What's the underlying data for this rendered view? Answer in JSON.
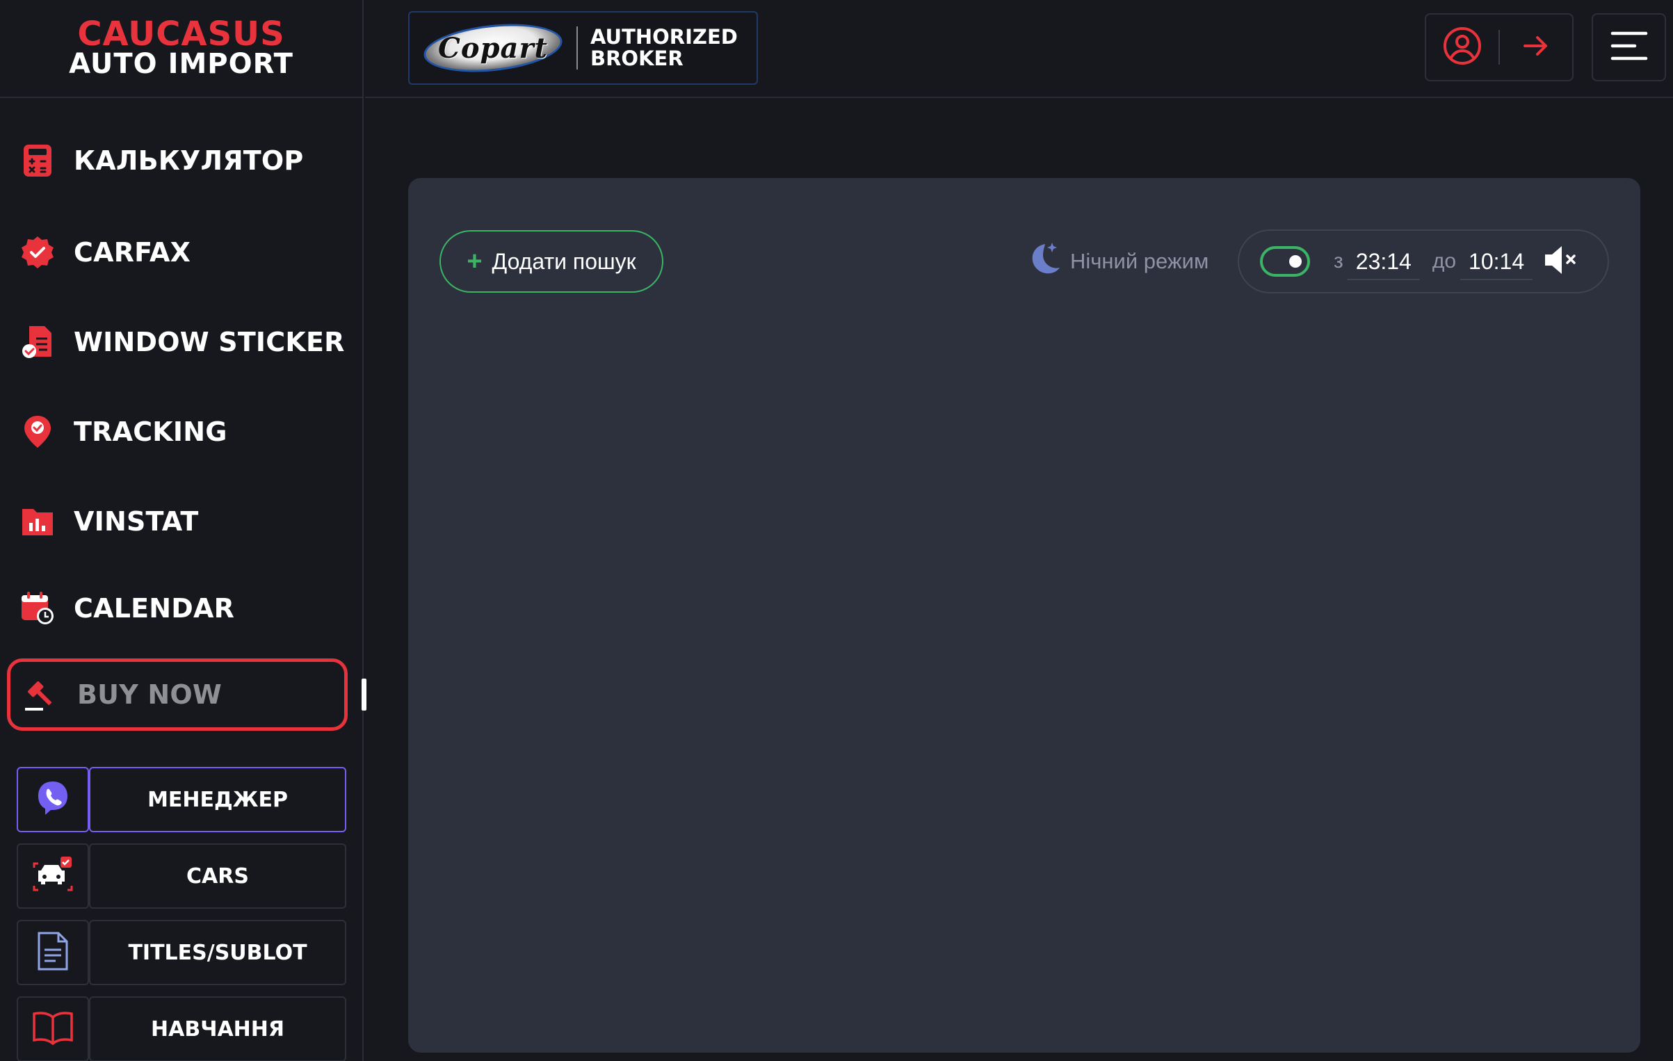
{
  "logo": {
    "line1": "CAUCASUS",
    "line2": "AUTO IMPORT"
  },
  "header": {
    "copart_logo_text": "Copart",
    "broker_line1": "AUTHORIZED",
    "broker_line2": "BROKER"
  },
  "nav": [
    {
      "label": "КАЛЬКУЛЯТОР",
      "icon": "calculator-icon"
    },
    {
      "label": "CARFAX",
      "icon": "badge-check-icon"
    },
    {
      "label": "WINDOW STICKER",
      "icon": "document-check-icon"
    },
    {
      "label": "TRACKING",
      "icon": "location-pin-icon"
    },
    {
      "label": "VINSTAT",
      "icon": "bar-chart-folder-icon"
    },
    {
      "label": "CALENDAR",
      "icon": "calendar-clock-icon"
    },
    {
      "label": "BUY NOW",
      "icon": "gavel-icon",
      "active": true
    }
  ],
  "quick": [
    {
      "label": "МЕНЕДЖЕР",
      "icon": "viber-icon"
    },
    {
      "label": "CARS",
      "icon": "car-check-icon"
    },
    {
      "label": "TITLES/SUBLOT",
      "icon": "document-icon"
    },
    {
      "label": "НАВЧАННЯ",
      "icon": "open-book-icon"
    }
  ],
  "toolbar": {
    "add_search": "Додати пошук",
    "night_mode": "Нічний режим",
    "from_label": "з",
    "from_time": "23:14",
    "to_label": "до",
    "to_time": "10:14"
  },
  "colors": {
    "accent": "#e8333c",
    "green": "#3bb565",
    "viber": "#7360f2",
    "panel": "#2d303d",
    "bg": "#17181d"
  }
}
